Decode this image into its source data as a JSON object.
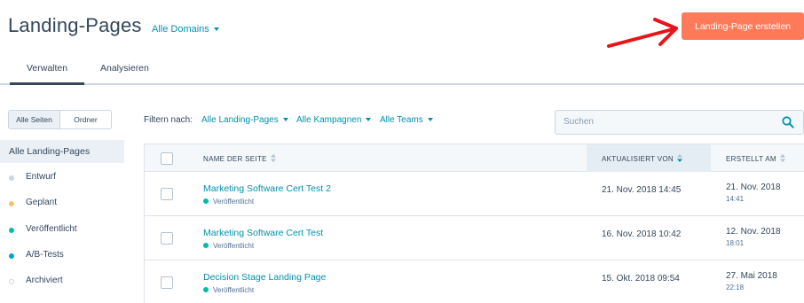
{
  "header": {
    "title": "Landing-Pages",
    "domain_filter": "Alle Domains",
    "create_button": "Landing-Page erstellen"
  },
  "tabs": [
    {
      "label": "Verwalten",
      "active": true
    },
    {
      "label": "Analysieren",
      "active": false
    }
  ],
  "view_toggle": {
    "all_pages": "Alle Seiten",
    "folder": "Ordner",
    "selected": "Alle Seiten"
  },
  "sidebar": {
    "heading": "Alle Landing-Pages",
    "items": [
      {
        "label": "Entwurf",
        "color": "#cbd6e2"
      },
      {
        "label": "Geplant",
        "color": "#f5c26b"
      },
      {
        "label": "Veröffentlicht",
        "color": "#00bda5"
      },
      {
        "label": "A/B-Tests",
        "color": "#00a4bd"
      },
      {
        "label": "Archiviert",
        "color": "#ffffff"
      }
    ]
  },
  "filters": {
    "label": "Filtern nach:",
    "pages": "Alle Landing-Pages",
    "campaigns": "Alle Kampagnen",
    "teams": "Alle Teams"
  },
  "search": {
    "placeholder": "Suchen"
  },
  "table": {
    "columns": [
      "NAME DER SEITE",
      "AKTUALISIERT VON",
      "ERSTELLT AM"
    ],
    "sorted_column": "AKTUALISIERT VON",
    "rows": [
      {
        "name": "Marketing Software Cert Test 2",
        "status": "Veröffentlicht",
        "updated": "21. Nov. 2018 14:45",
        "created_date": "21. Nov. 2018",
        "created_time": "14:41"
      },
      {
        "name": "Marketing Software Cert Test",
        "status": "Veröffentlicht",
        "updated": "16. Nov. 2018 10:42",
        "created_date": "12. Nov. 2018",
        "created_time": "18:01"
      },
      {
        "name": "Decision Stage Landing Page",
        "status": "Veröffentlicht",
        "updated": "15. Okt. 2018 09:54",
        "created_date": "27. Mai 2018",
        "created_time": "22:18"
      }
    ]
  },
  "colors": {
    "accent": "#ff7a59",
    "link": "#0091ae",
    "text": "#33475b",
    "annotation_arrow": "#e8141a"
  }
}
